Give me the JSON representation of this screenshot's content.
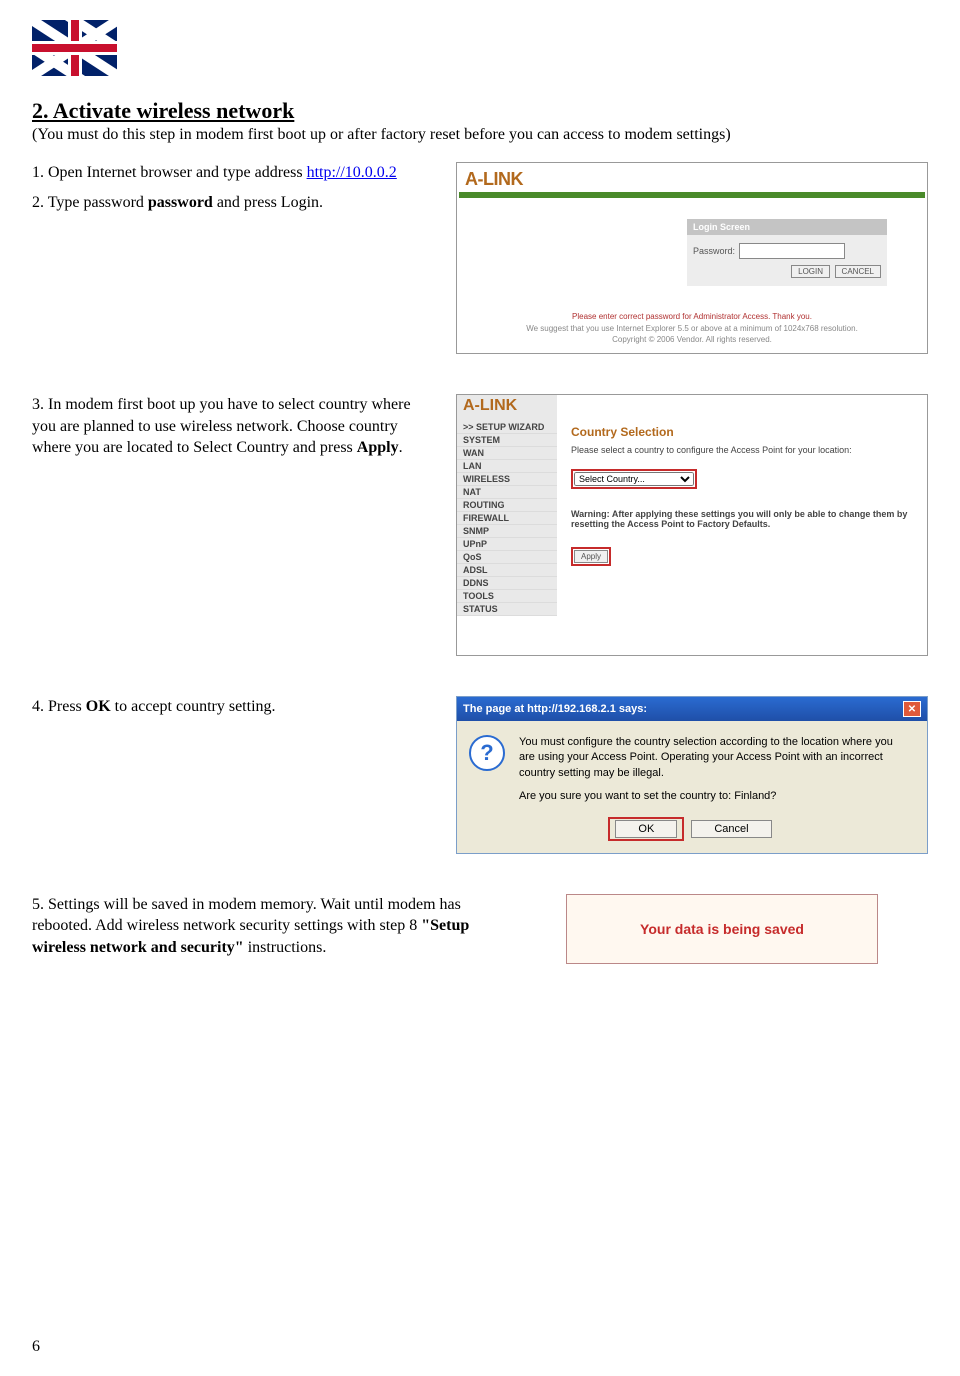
{
  "heading": "2. Activate wireless network",
  "subtitle": "(You must do this step in modem first boot up or after factory reset before you can access to modem settings)",
  "step1": {
    "prefix": "1. Open Internet browser and type address ",
    "link": "http://10.0.0.2"
  },
  "step2": {
    "prefix": "2. Type password ",
    "bold": "password",
    "suffix": " and press Login."
  },
  "step3": {
    "text": "3. In modem first boot up you have to select country where you are planned to use wireless network. Choose country where you are located to Select Country and press ",
    "bold": "Apply",
    "suffix": "."
  },
  "step4": {
    "prefix": "4. Press ",
    "bold": "OK",
    "suffix": " to accept country setting."
  },
  "step5": {
    "prefix": "5. Settings will be saved in modem memory. Wait until modem has rebooted. Add wireless network security settings with step 8 ",
    "bold": "\"Setup wireless network and security\"",
    "suffix": " instructions."
  },
  "shot1": {
    "brand": "A-LINK",
    "login_title": "Login Screen",
    "password_label": "Password:",
    "login_btn": "LOGIN",
    "cancel_btn": "CANCEL",
    "foot_red": "Please enter correct password for Administrator Access. Thank you.",
    "foot1": "We suggest that you use Internet Explorer 5.5 or above at a minimum of 1024x768 resolution.",
    "foot2": "Copyright © 2006 Vendor. All rights reserved."
  },
  "shot2": {
    "brand": "A-LINK",
    "menu": [
      ">> SETUP WIZARD",
      "SYSTEM",
      "WAN",
      "LAN",
      "WIRELESS",
      "NAT",
      "ROUTING",
      "FIREWALL",
      "SNMP",
      "UPnP",
      "QoS",
      "ADSL",
      "DDNS",
      "TOOLS",
      "STATUS"
    ],
    "title": "Country Selection",
    "sub": "Please select a country to configure the Access Point for your location:",
    "select_placeholder": "Select Country...",
    "warning": "Warning: After applying these settings you will only be able to change them by resetting the Access Point to Factory Defaults.",
    "apply": "Apply"
  },
  "shot3": {
    "title": "The page at http://192.168.2.1 says:",
    "body1": "You must configure the country selection according to the location where you are using your Access Point. Operating your Access Point with an incorrect country setting may be illegal.",
    "body2": "Are you sure you want to set the country to: Finland?",
    "ok": "OK",
    "cancel": "Cancel"
  },
  "shot4": {
    "text": "Your data is being saved"
  },
  "page_number": "6"
}
